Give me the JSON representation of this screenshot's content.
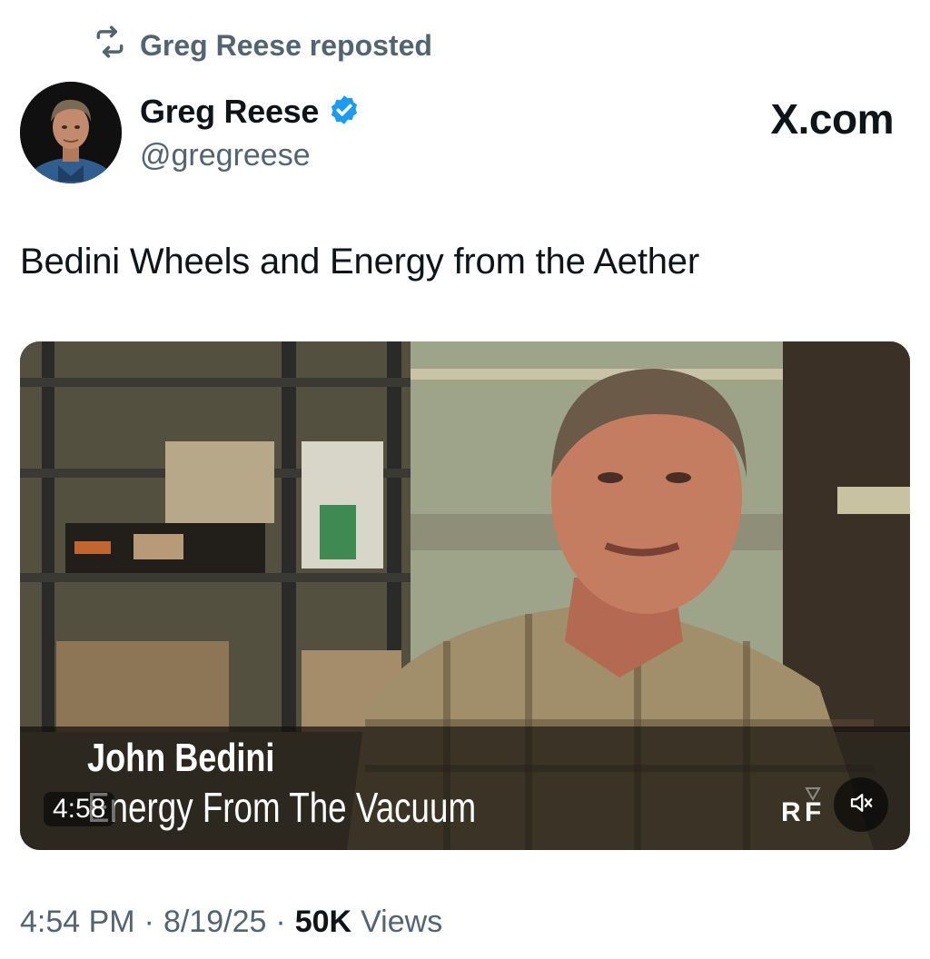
{
  "repost": {
    "label": "Greg Reese reposted",
    "icon": "repost-icon"
  },
  "author": {
    "display_name": "Greg Reese",
    "handle": "@gregreese",
    "verified": true,
    "verified_color": "#1d9bf0",
    "avatar_icon": "avatar"
  },
  "brand": {
    "label": "X.com"
  },
  "post": {
    "text": "Bedini Wheels and Energy from the Aether"
  },
  "video": {
    "duration": "4:58",
    "caption_name": "John Bedini",
    "caption_subtitle": "Energy From The Vacuum",
    "muted": true,
    "mute_icon": "speaker-muted-icon"
  },
  "meta": {
    "time": "4:54 PM",
    "separator": "·",
    "date": "8/19/25",
    "views_count": "50K",
    "views_label": "Views"
  },
  "colors": {
    "text": "#0f1419",
    "secondary": "#536471",
    "verified": "#1d9bf0"
  }
}
